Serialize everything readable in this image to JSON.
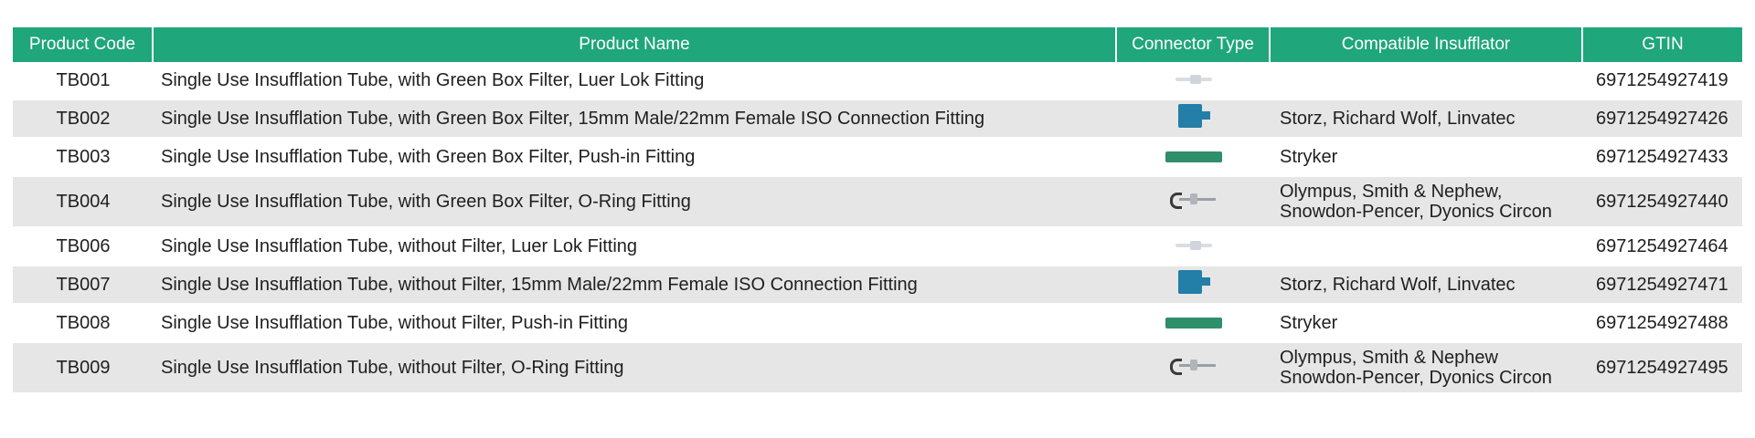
{
  "header": {
    "product_code": "Product Code",
    "product_name": "Product Name",
    "connector_type": "Connector Type",
    "compatible_insufflator": "Compatible Insufflator",
    "gtin": "GTIN"
  },
  "colors": {
    "header_bg": "#1fa67a",
    "row_shade": "#e6e6e6",
    "iso_connector": "#237ea8",
    "pushin_connector": "#2f8f6a"
  },
  "rows": [
    {
      "code": "TB001",
      "name": "Single Use Insufflation Tube,  with Green Box Filter, Luer Lok Fitting",
      "connector": "luer-lok-icon",
      "compat1": "",
      "compat2": "",
      "gtin": "6971254927419"
    },
    {
      "code": "TB002",
      "name": "Single Use Insufflation Tube, with Green Box Filter, 15mm Male/22mm Female ISO Connection Fitting",
      "connector": "iso-connector-icon",
      "compat1": "Storz,  Richard Wolf,  Linvatec",
      "compat2": "",
      "gtin": "6971254927426"
    },
    {
      "code": "TB003",
      "name": "Single Use Insufflation Tube, with Green Box Filter, Push-in Fitting",
      "connector": "push-in-icon",
      "compat1": "Stryker",
      "compat2": "",
      "gtin": "6971254927433"
    },
    {
      "code": "TB004",
      "name": "Single Use Insufflation Tube, with Green Box Filter, O-Ring Fitting",
      "connector": "o-ring-icon",
      "compat1": "Olympus,  Smith & Nephew,",
      "compat2": "Snowdon-Pencer,  Dyonics Circon",
      "gtin": "6971254927440"
    },
    {
      "code": "TB006",
      "name": "Single Use Insufflation Tube,  without Filter, Luer Lok Fitting",
      "connector": "luer-lok-icon",
      "compat1": "",
      "compat2": "",
      "gtin": "6971254927464"
    },
    {
      "code": "TB007",
      "name": "Single Use Insufflation Tube, without Filter, 15mm Male/22mm Female ISO Connection Fitting",
      "connector": "iso-connector-icon",
      "compat1": "Storz,  Richard Wolf,  Linvatec",
      "compat2": "",
      "gtin": "6971254927471"
    },
    {
      "code": "TB008",
      "name": "Single Use Insufflation Tube, without Filter, Push-in Fitting",
      "connector": "push-in-icon",
      "compat1": "Stryker",
      "compat2": "",
      "gtin": "6971254927488"
    },
    {
      "code": "TB009",
      "name": "Single Use Insufflation Tube, without Filter, O-Ring Fitting",
      "connector": "o-ring-icon",
      "compat1": "Olympus,  Smith & Nephew",
      "compat2": "Snowdon-Pencer,  Dyonics Circon",
      "gtin": "6971254927495"
    }
  ]
}
